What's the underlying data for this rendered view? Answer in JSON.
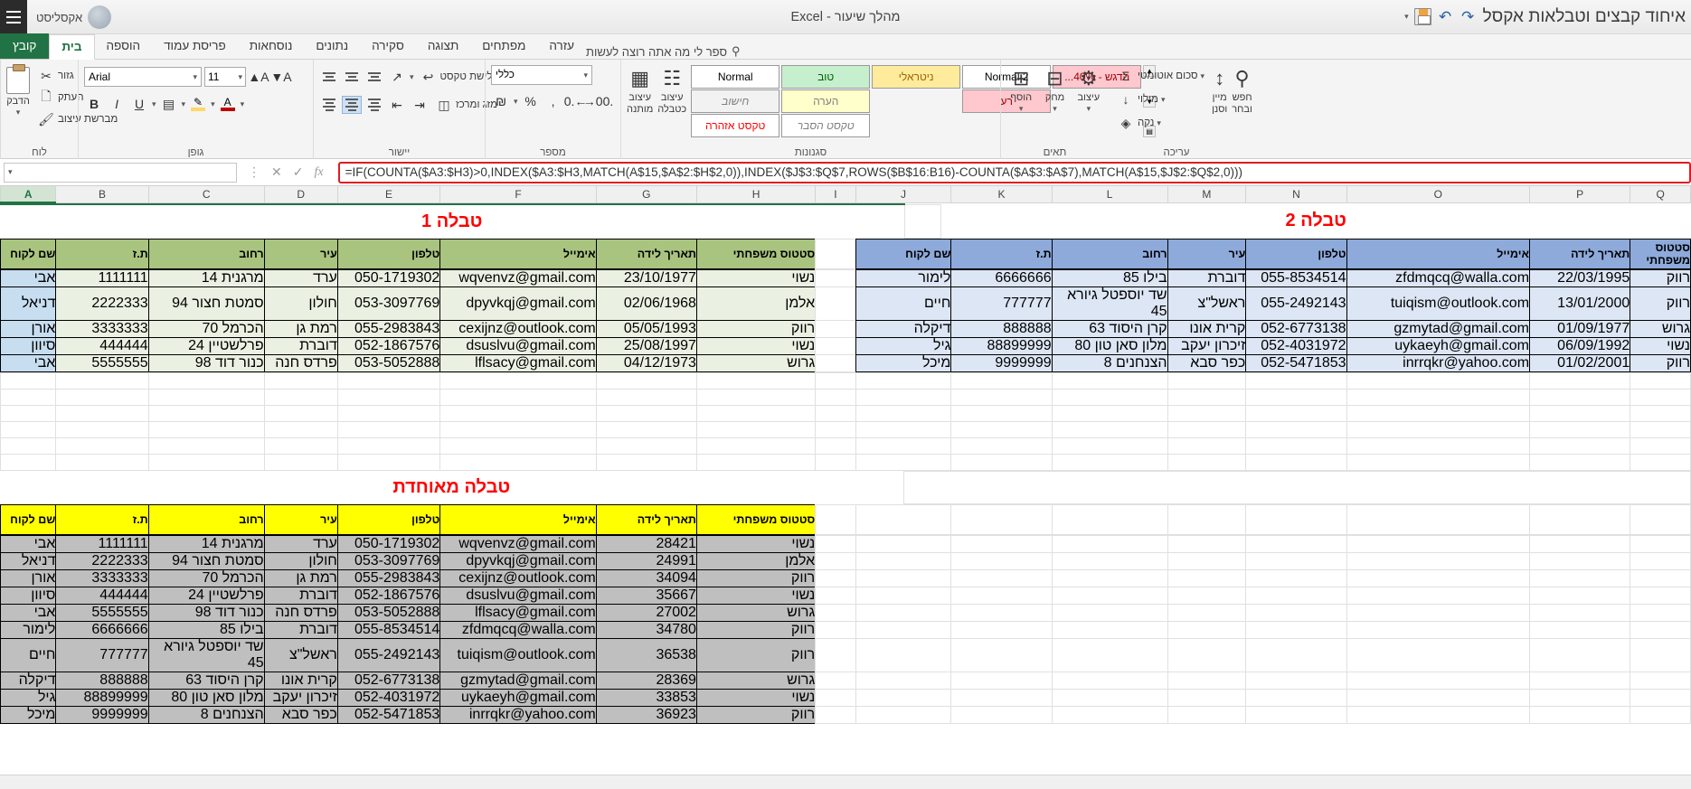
{
  "window": {
    "title": "איחוד קבצים וטבלאות אקסל",
    "document_title": "מהלך שיעור - Excel",
    "account": "אקסליסט",
    "qat": {
      "save": "save-icon",
      "undo": "undo-icon",
      "redo": "redo-icon",
      "customize": "customize-caret-icon"
    }
  },
  "ribbon": {
    "file_tab": "קובץ",
    "tabs": [
      {
        "label": "בית",
        "active": true
      },
      {
        "label": "הוספה",
        "active": false
      },
      {
        "label": "פריסת עמוד",
        "active": false
      },
      {
        "label": "נוסחאות",
        "active": false
      },
      {
        "label": "נתונים",
        "active": false
      },
      {
        "label": "סקירה",
        "active": false
      },
      {
        "label": "תצוגה",
        "active": false
      },
      {
        "label": "מפתחים",
        "active": false
      },
      {
        "label": "עזרה",
        "active": false
      }
    ],
    "tell_me": "ספר לי מה אתה רוצה לעשות",
    "groups": [
      {
        "name": "לוח"
      },
      {
        "name": "גופן"
      },
      {
        "name": "יישור"
      },
      {
        "name": "מספר"
      },
      {
        "name": "סגנונות"
      },
      {
        "name": "תאים"
      },
      {
        "name": "עריכה"
      }
    ],
    "clipboard": {
      "paste": "הדבק",
      "cut": "גזור",
      "copy": "העתק",
      "format_painter": "מברשת עיצוב"
    },
    "font": {
      "font_name": "Arial",
      "font_size": "11",
      "grow": "A",
      "shrink": "A",
      "bold": "B",
      "italic": "I",
      "underline": "U",
      "borders": "גבולות",
      "fill_color": "צבע מילוי",
      "font_color": "צבע גופן"
    },
    "alignment": {
      "wrap_text": "גלישת טקסט",
      "merge_center": "מזג ומרכז"
    },
    "number": {
      "format": "כללי",
      "percent": "%",
      "comma": ",",
      "currency": "₪",
      "increase_decimal": "הוסף מקום עשרוני",
      "decrease_decimal": "הקטן מקום עשרוני"
    },
    "styles": {
      "conditional_formatting": "עיצוב מותנה",
      "format_as_table": "עיצוב כטבלה",
      "cell_styles": "סגנונות תאים",
      "items": [
        {
          "label": "Normal",
          "class": "sty-normal"
        },
        {
          "label": "טוב",
          "class": "sty-tov"
        },
        {
          "label": "ניטראלי",
          "class": "sty-neutral"
        },
        {
          "label": "Normal 2",
          "class": "sty-normal2"
        },
        {
          "label": "הדגש - 40%...",
          "class": "sty-highl"
        },
        {
          "label": "רע",
          "class": "sty-ra"
        },
        {
          "label": "חישוב",
          "class": "sty-hishuv"
        },
        {
          "label": "הערה",
          "class": "sty-hearah"
        },
        {
          "label": "טקסט אזהרה",
          "class": "sty-warn"
        },
        {
          "label": "טקסט הסבר",
          "class": "sty-expl"
        }
      ]
    },
    "cells": {
      "insert": "הוסף",
      "delete": "מחק",
      "format": "עיצוב"
    },
    "editing": {
      "autosum": "סכום אוטומטי",
      "fill": "מילוי",
      "clear": "נקה",
      "sort_filter": "מיין וסנן",
      "find_select": "חפש ובחר"
    }
  },
  "formula_bar": {
    "name_box": "",
    "cancel_icon": "cancel-icon",
    "confirm_icon": "confirm-icon",
    "fx_icon": "fx-icon",
    "formula": "=IF(COUNTA($A3:$H3)>0,INDEX($A3:$H3,MATCH(A$15,$A$2:$H$2,0)),INDEX($J$3:$Q$7,ROWS($B$16:B16)-COUNTA($A$3:$A$7),MATCH(A$15,$J$2:$Q$2,0)))"
  },
  "grid": {
    "column_headers": [
      "Q",
      "P",
      "O",
      "N",
      "M",
      "L",
      "K",
      "J",
      "I",
      "H",
      "G",
      "F",
      "E",
      "D",
      "C",
      "B",
      "A"
    ],
    "selected_column": "A"
  },
  "tables": {
    "table1": {
      "title": "טבלה 1",
      "headers": [
        "סטטוס משפחתי",
        "תאריך לידה",
        "אימייל",
        "טלפון",
        "עיר",
        "רחוב",
        "ת.ז",
        "שם לקוח"
      ],
      "rows": [
        [
          "נשוי",
          "23/10/1977",
          "wqvenvz@gmail.com",
          "050-1719302",
          "ערד",
          "מרגנית 14",
          "1111111",
          "אבי"
        ],
        [
          "אלמן",
          "02/06/1968",
          "dpyvkqj@gmail.com",
          "053-3097769",
          "חולון",
          "סמטת חצור 94",
          "2222333",
          "דניאל"
        ],
        [
          "רווק",
          "05/05/1993",
          "cexijnz@outlook.com",
          "055-2983843",
          "רמת גן",
          "הכרמל 70",
          "3333333",
          "אורן"
        ],
        [
          "נשוי",
          "25/08/1997",
          "dsuslvu@gmail.com",
          "052-1867576",
          "דוברת",
          "פרלשטיין 24",
          "444444",
          "סיוון"
        ],
        [
          "גרוש",
          "04/12/1973",
          "lflsacy@gmail.com",
          "053-5052888",
          "פרדס חנה",
          "כנור דוד 98",
          "5555555",
          "אבי"
        ]
      ]
    },
    "table2": {
      "title": "טבלה 2",
      "headers": [
        "סטטוס משפחתי",
        "תאריך לידה",
        "אימייל",
        "טלפון",
        "עיר",
        "רחוב",
        "ת.ז",
        "שם לקוח"
      ],
      "rows": [
        [
          "רווק",
          "22/03/1995",
          "zfdmqcq@walla.com",
          "055-8534514",
          "דוברת",
          "בילו 85",
          "6666666",
          "לימור"
        ],
        [
          "רווק",
          "13/01/2000",
          "tuiqism@outlook.com",
          "055-2492143",
          "ראשל\"צ",
          "שד יוספטל גיורא 45",
          "777777",
          "חיים"
        ],
        [
          "גרוש",
          "01/09/1977",
          "gzmytad@gmail.com",
          "052-6773138",
          "קרית אונו",
          "קרן היסוד 63",
          "888888",
          "דיקלה"
        ],
        [
          "נשוי",
          "06/09/1992",
          "uykaeyh@gmail.com",
          "052-4031972",
          "זיכרון יעקב",
          "מלון סאן טון 80",
          "88899999",
          "גיל"
        ],
        [
          "רווק",
          "01/02/2001",
          "inrrqkr@yahoo.com",
          "052-5471853",
          "כפר סבא",
          "הצנחנים 8",
          "9999999",
          "מיכל"
        ]
      ]
    },
    "merged": {
      "title": "טבלה מאוחדת",
      "headers": [
        "סטטוס משפחתי",
        "תאריך לידה",
        "אימייל",
        "טלפון",
        "עיר",
        "רחוב",
        "ת.ז",
        "שם לקוח"
      ],
      "rows": [
        [
          "נשוי",
          "28421",
          "wqvenvz@gmail.com",
          "050-1719302",
          "ערד",
          "מרגנית 14",
          "1111111",
          "אבי"
        ],
        [
          "אלמן",
          "24991",
          "dpyvkqj@gmail.com",
          "053-3097769",
          "חולון",
          "סמטת חצור 94",
          "2222333",
          "דניאל"
        ],
        [
          "רווק",
          "34094",
          "cexijnz@outlook.com",
          "055-2983843",
          "רמת גן",
          "הכרמל 70",
          "3333333",
          "אורן"
        ],
        [
          "נשוי",
          "35667",
          "dsuslvu@gmail.com",
          "052-1867576",
          "דוברת",
          "פרלשטיין 24",
          "444444",
          "סיוון"
        ],
        [
          "גרוש",
          "27002",
          "lflsacy@gmail.com",
          "053-5052888",
          "פרדס חנה",
          "כנור דוד 98",
          "5555555",
          "אבי"
        ],
        [
          "רווק",
          "34780",
          "zfdmqcq@walla.com",
          "055-8534514",
          "דוברת",
          "בילו 85",
          "6666666",
          "לימור"
        ],
        [
          "רווק",
          "36538",
          "tuiqism@outlook.com",
          "055-2492143",
          "ראשל\"צ",
          "שד יוספטל גיורא 45",
          "777777",
          "חיים"
        ],
        [
          "גרוש",
          "28369",
          "gzmytad@gmail.com",
          "052-6773138",
          "קרית אונו",
          "קרן היסוד 63",
          "888888",
          "דיקלה"
        ],
        [
          "נשוי",
          "33853",
          "uykaeyh@gmail.com",
          "052-4031972",
          "זיכרון יעקב",
          "מלון סאן טון 80",
          "88899999",
          "גיל"
        ],
        [
          "רווק",
          "36923",
          "inrrqkr@yahoo.com",
          "052-5471853",
          "כפר סבא",
          "הצנחנים 8",
          "9999999",
          "מיכל"
        ]
      ]
    }
  },
  "colors": {
    "excel_green": "#217346",
    "title_red": "#ff0000",
    "table1_header": "#a9c47f",
    "table2_header": "#8eaadb",
    "merged_header": "#ffff00",
    "formula_outline": "#e01b24"
  }
}
